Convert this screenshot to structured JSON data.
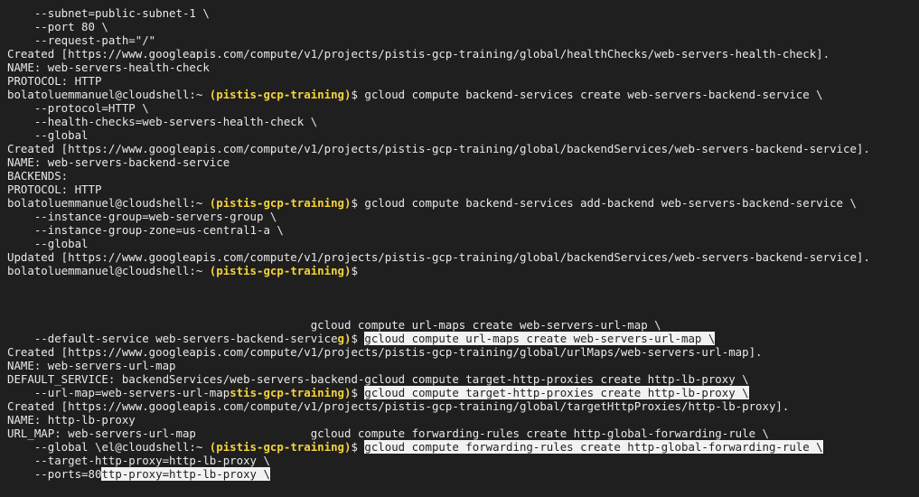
{
  "terminal": {
    "lines": [
      [
        {
          "t": "    --subnet=public-subnet-1 \\",
          "c": "txt"
        }
      ],
      [
        {
          "t": "    --port 80 \\",
          "c": "txt"
        }
      ],
      [
        {
          "t": "    --request-path=\"/\"",
          "c": "txt"
        }
      ],
      [
        {
          "t": "Created [https://www.googleapis.com/compute/v1/projects/pistis-gcp-training/global/healthChecks/web-servers-health-check].",
          "c": "txt"
        }
      ],
      [
        {
          "t": "NAME: web-servers-health-check",
          "c": "txt"
        }
      ],
      [
        {
          "t": "PROTOCOL: HTTP",
          "c": "txt"
        }
      ],
      [
        {
          "t": "bolatoluemmanuel@cloudshell:~ ",
          "c": "user"
        },
        {
          "t": "(pistis-gcp-training)",
          "c": "project"
        },
        {
          "t": "$ gcloud compute backend-services create web-servers-backend-service \\",
          "c": "txt"
        }
      ],
      [
        {
          "t": "    --protocol=HTTP \\",
          "c": "txt"
        }
      ],
      [
        {
          "t": "    --health-checks=web-servers-health-check \\",
          "c": "txt"
        }
      ],
      [
        {
          "t": "    --global",
          "c": "txt"
        }
      ],
      [
        {
          "t": "Created [https://www.googleapis.com/compute/v1/projects/pistis-gcp-training/global/backendServices/web-servers-backend-service].",
          "c": "txt"
        }
      ],
      [
        {
          "t": "NAME: web-servers-backend-service",
          "c": "txt"
        }
      ],
      [
        {
          "t": "BACKENDS:",
          "c": "txt"
        }
      ],
      [
        {
          "t": "PROTOCOL: HTTP",
          "c": "txt"
        }
      ],
      [
        {
          "t": "bolatoluemmanuel@cloudshell:~ ",
          "c": "user"
        },
        {
          "t": "(pistis-gcp-training)",
          "c": "project"
        },
        {
          "t": "$ gcloud compute backend-services add-backend web-servers-backend-service \\",
          "c": "txt"
        }
      ],
      [
        {
          "t": "    --instance-group=web-servers-group \\",
          "c": "txt"
        }
      ],
      [
        {
          "t": "    --instance-group-zone=us-central1-a \\",
          "c": "txt"
        }
      ],
      [
        {
          "t": "    --global",
          "c": "txt"
        }
      ],
      [
        {
          "t": "Updated [https://www.googleapis.com/compute/v1/projects/pistis-gcp-training/global/backendServices/web-servers-backend-service].",
          "c": "txt"
        }
      ],
      [
        {
          "t": "bolatoluemmanuel@cloudshell:~ ",
          "c": "user"
        },
        {
          "t": "(pistis-gcp-training)",
          "c": "project"
        },
        {
          "t": "$",
          "c": "txt"
        }
      ],
      [],
      [],
      [],
      [
        {
          "t": "                                             gcloud compute url-maps create web-servers-url-map \\",
          "c": "txt"
        }
      ],
      [
        {
          "t": "    --default-service web-servers-backend-service",
          "c": "txt"
        },
        {
          "t": "g)",
          "c": "project"
        },
        {
          "t": "$ ",
          "c": "txt"
        },
        {
          "t": "gcloud compute url-maps create web-servers-url-map \\",
          "c": "hl"
        }
      ],
      [
        {
          "t": "Created [https://www.googleapis.com/compute/v1/projects/pistis-gcp-training/global/urlMaps/web-servers-url-map].",
          "c": "txt"
        }
      ],
      [
        {
          "t": "NAME: web-servers-url-map",
          "c": "txt"
        }
      ],
      [
        {
          "t": "DEFAULT_SERVICE: backendServices/web-servers-backend-gcloud compute target-http-proxies create http-lb-proxy \\",
          "c": "txt"
        }
      ],
      [
        {
          "t": "    --url-map=web-servers-url-map",
          "c": "txt"
        },
        {
          "t": "stis-gcp-training)",
          "c": "project"
        },
        {
          "t": "$ ",
          "c": "txt"
        },
        {
          "t": "gcloud compute target-http-proxies create http-lb-proxy \\",
          "c": "hl"
        }
      ],
      [
        {
          "t": "Created [https://www.googleapis.com/compute/v1/projects/pistis-gcp-training/global/targetHttpProxies/http-lb-proxy].",
          "c": "txt"
        }
      ],
      [
        {
          "t": "NAME: http-lb-proxy",
          "c": "txt"
        }
      ],
      [
        {
          "t": "URL_MAP: web-servers-url-map                 gcloud compute forwarding-rules create http-global-forwarding-rule \\",
          "c": "txt"
        }
      ],
      [
        {
          "t": "    --global \\",
          "c": "txt"
        },
        {
          "t": "el@cloudshell:~ ",
          "c": "user"
        },
        {
          "t": "(pistis-gcp-training)",
          "c": "project"
        },
        {
          "t": "$ ",
          "c": "txt"
        },
        {
          "t": "gcloud compute forwarding-rules create http-global-forwarding-rule \\",
          "c": "hl"
        }
      ],
      [
        {
          "t": "    --target-http-proxy=http-lb-proxy \\",
          "c": "txt"
        }
      ],
      [
        {
          "t": "    --ports=80",
          "c": "txt"
        },
        {
          "t": "ttp-proxy=http-lb-proxy \\",
          "c": "hl"
        }
      ]
    ]
  }
}
